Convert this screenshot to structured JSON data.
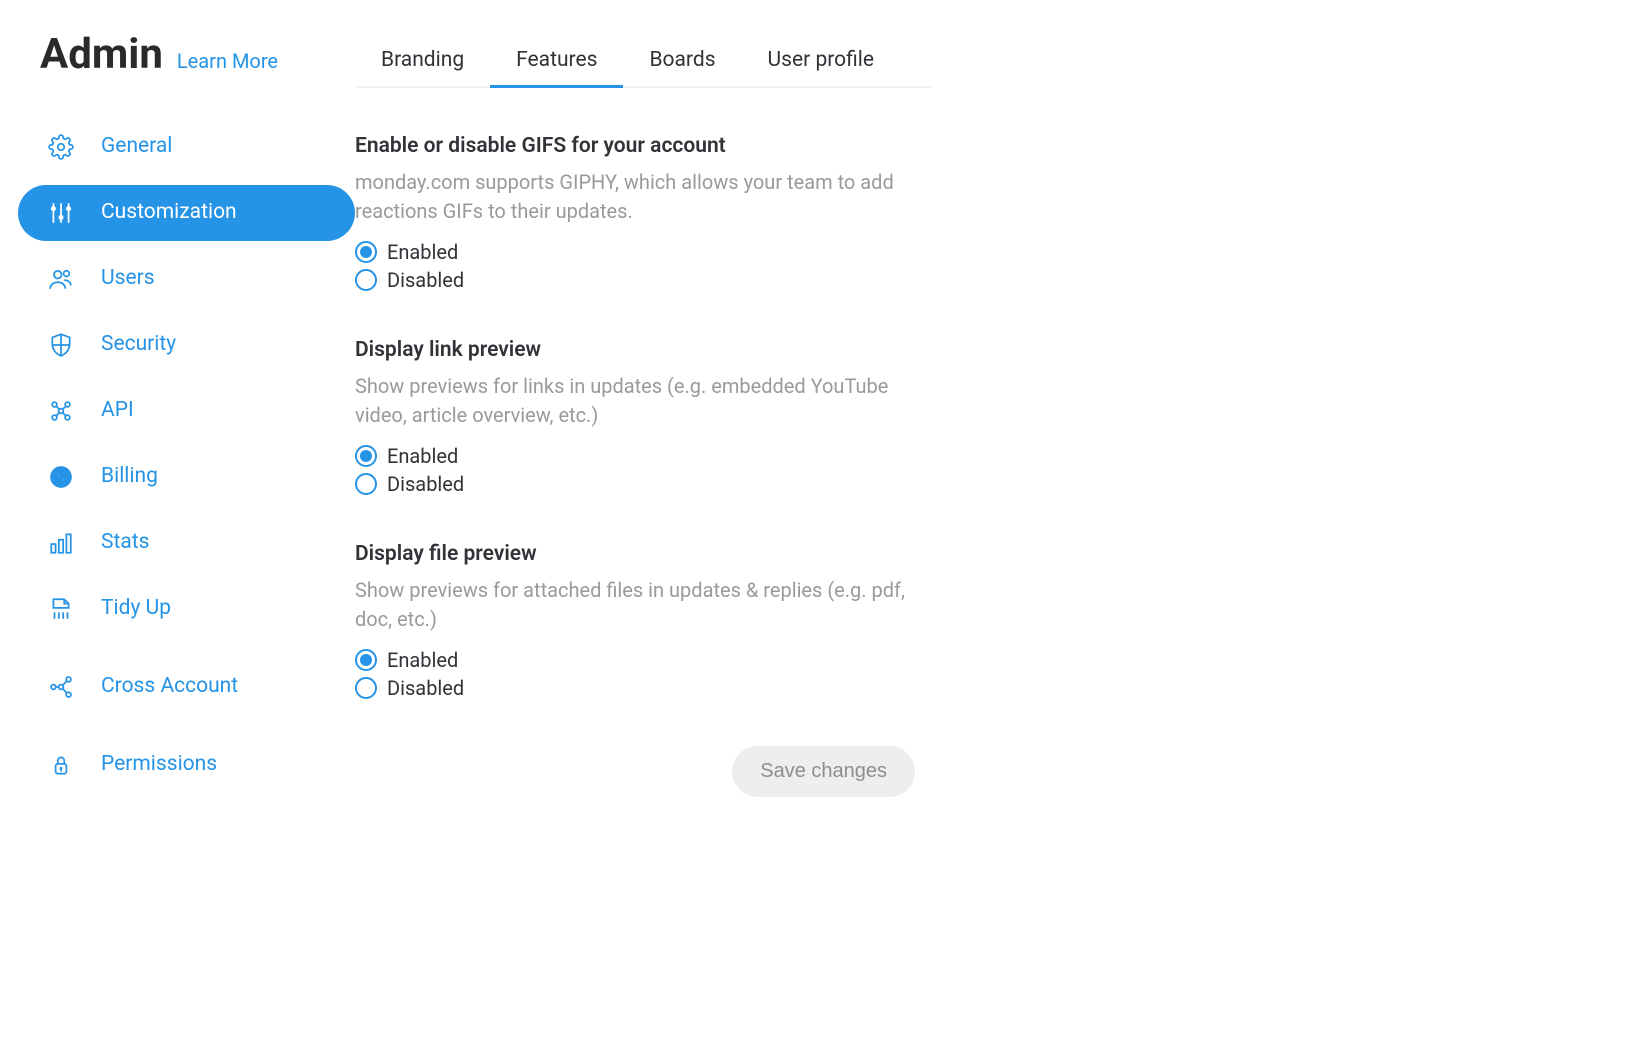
{
  "header": {
    "title": "Admin",
    "learn_more": "Learn More"
  },
  "sidebar": {
    "items": [
      {
        "label": "General",
        "icon": "gear-icon",
        "name": "sidebar-item-general"
      },
      {
        "label": "Customization",
        "icon": "sliders-icon",
        "name": "sidebar-item-customization",
        "active": true
      },
      {
        "label": "Users",
        "icon": "users-icon",
        "name": "sidebar-item-users"
      },
      {
        "label": "Security",
        "icon": "shield-icon",
        "name": "sidebar-item-security"
      },
      {
        "label": "API",
        "icon": "api-icon",
        "name": "sidebar-item-api"
      },
      {
        "label": "Billing",
        "icon": "billing-icon",
        "name": "sidebar-item-billing"
      },
      {
        "label": "Stats",
        "icon": "stats-icon",
        "name": "sidebar-item-stats"
      },
      {
        "label": "Tidy Up",
        "icon": "tidyup-icon",
        "name": "sidebar-item-tidyup"
      },
      {
        "label": "Cross Account",
        "icon": "crossaccount-icon",
        "name": "sidebar-item-crossaccount"
      },
      {
        "label": "Permissions",
        "icon": "permissions-icon",
        "name": "sidebar-item-permissions"
      }
    ]
  },
  "tabs": [
    {
      "label": "Branding",
      "name": "tab-branding"
    },
    {
      "label": "Features",
      "name": "tab-features",
      "active": true
    },
    {
      "label": "Boards",
      "name": "tab-boards"
    },
    {
      "label": "User profile",
      "name": "tab-userprofile"
    }
  ],
  "settings": [
    {
      "name": "setting-gifs",
      "title": "Enable or disable GIFS for your account",
      "desc": "monday.com supports GIPHY, which allows your team to add reactions GIFs to their updates.",
      "options": [
        {
          "label": "Enabled",
          "checked": true
        },
        {
          "label": "Disabled",
          "checked": false
        }
      ]
    },
    {
      "name": "setting-link-preview",
      "title": "Display link preview",
      "desc": "Show previews for links in updates (e.g. embedded YouTube video, article overview, etc.)",
      "options": [
        {
          "label": "Enabled",
          "checked": true
        },
        {
          "label": "Disabled",
          "checked": false
        }
      ]
    },
    {
      "name": "setting-file-preview",
      "title": "Display file preview",
      "desc": "Show previews for attached files in updates & replies (e.g. pdf, doc, etc.)",
      "options": [
        {
          "label": "Enabled",
          "checked": true
        },
        {
          "label": "Disabled",
          "checked": false
        }
      ]
    }
  ],
  "save_button": "Save changes"
}
